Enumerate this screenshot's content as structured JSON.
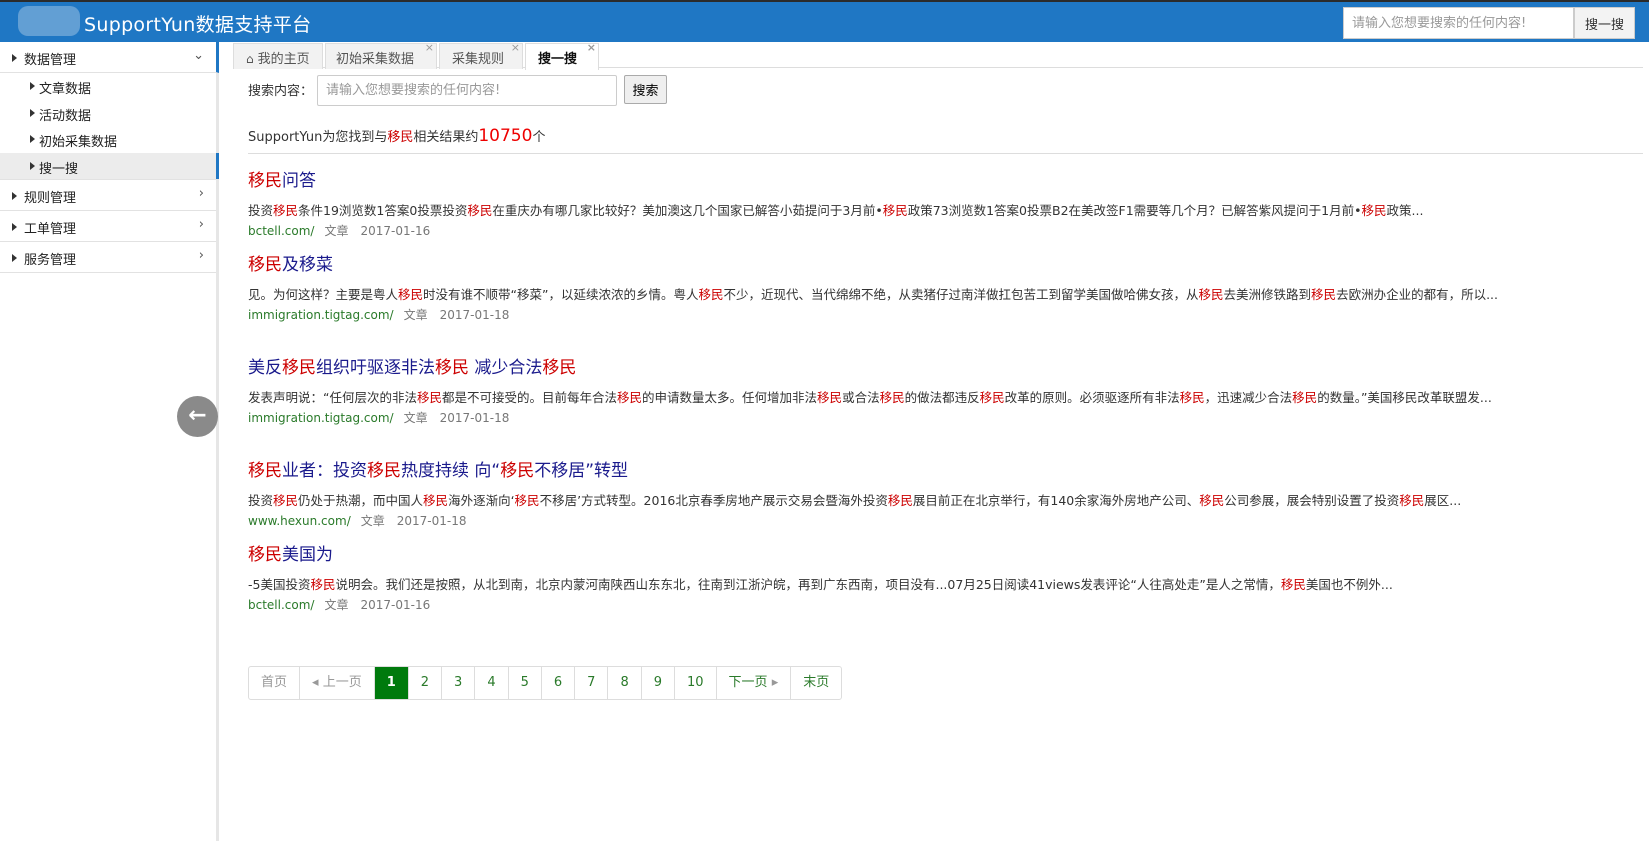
{
  "header": {
    "title": "SupportYun数据支持平台",
    "search_placeholder": "请输入您想要搜索的任何内容!",
    "search_button": "搜一搜"
  },
  "sidebar": {
    "groups": [
      {
        "label": "数据管理",
        "chevron": "⌄",
        "open": true,
        "items": [
          "文章数据",
          "活动数据",
          "初始采集数据",
          "搜一搜"
        ]
      },
      {
        "label": "规则管理",
        "chevron": "›"
      },
      {
        "label": "工单管理",
        "chevron": "›"
      },
      {
        "label": "服务管理",
        "chevron": "›"
      }
    ],
    "collapse_icon": "←"
  },
  "tabs": [
    {
      "label": "我的主页",
      "icon": "home-icon"
    },
    {
      "label": "初始采集数据",
      "close": "×"
    },
    {
      "label": "采集规则",
      "close": "×"
    },
    {
      "label": "搜一搜",
      "close": "×",
      "active": true
    }
  ],
  "search": {
    "label": "搜索内容：",
    "placeholder": "请输入您想要搜索的任何内容!",
    "button": "搜索"
  },
  "summary": {
    "prefix": "SupportYun为您找到与",
    "keyword": "移民",
    "middle": "相关结果约",
    "count": "10750",
    "suffix": "个"
  },
  "results": [
    {
      "title": [
        {
          "t": "移民",
          "h": true
        },
        {
          "t": "问答"
        }
      ],
      "snippet": [
        {
          "t": "投资"
        },
        {
          "t": "移民",
          "h": true
        },
        {
          "t": "条件19浏览数1答案0投票投资"
        },
        {
          "t": "移民",
          "h": true
        },
        {
          "t": "在重庆办有哪几家比较好？美加澳这几个国家已解答小茹提问于3月前•"
        },
        {
          "t": "移民",
          "h": true
        },
        {
          "t": "政策73浏览数1答案0投票B2在美改签F1需要等几个月？已解答紫风提问于1月前•"
        },
        {
          "t": "移民",
          "h": true
        },
        {
          "t": "政策..."
        }
      ],
      "url": "bctell.com/",
      "type": "文章",
      "date": "2017-01-16"
    },
    {
      "title": [
        {
          "t": "移民",
          "h": true
        },
        {
          "t": "及移菜"
        }
      ],
      "snippet": [
        {
          "t": "见。为何这样？主要是粤人"
        },
        {
          "t": "移民",
          "h": true
        },
        {
          "t": "时没有谁不顺带“移菜”，以延续浓浓的乡情。粤人"
        },
        {
          "t": "移民",
          "h": true
        },
        {
          "t": "不少，近现代、当代绵绵不绝，从卖猪仔过南洋做扛包苦工到留学美国做哈佛女孩，从"
        },
        {
          "t": "移民",
          "h": true
        },
        {
          "t": "去美洲修铁路到"
        },
        {
          "t": "移民",
          "h": true
        },
        {
          "t": "去欧洲办企业的都有，所以..."
        }
      ],
      "url": "immigration.tigtag.com/",
      "type": "文章",
      "date": "2017-01-18"
    },
    {
      "title": [
        {
          "t": "美反"
        },
        {
          "t": "移民",
          "h": true
        },
        {
          "t": "组织吁驱逐非法"
        },
        {
          "t": "移民",
          "h": true
        },
        {
          "t": " 减少合法"
        },
        {
          "t": "移民",
          "h": true
        }
      ],
      "snippet": [
        {
          "t": "发表声明说：“任何层次的非法"
        },
        {
          "t": "移民",
          "h": true
        },
        {
          "t": "都是不可接受的。目前每年合法"
        },
        {
          "t": "移民",
          "h": true
        },
        {
          "t": "的申请数量太多。任何增加非法"
        },
        {
          "t": "移民",
          "h": true
        },
        {
          "t": "或合法"
        },
        {
          "t": "移民",
          "h": true
        },
        {
          "t": "的做法都违反"
        },
        {
          "t": "移民",
          "h": true
        },
        {
          "t": "改革的原则。必须驱逐所有非法"
        },
        {
          "t": "移民",
          "h": true
        },
        {
          "t": "，迅速减少合法"
        },
        {
          "t": "移民",
          "h": true
        },
        {
          "t": "的数量。”美国移民改革联盟发..."
        }
      ],
      "url": "immigration.tigtag.com/",
      "type": "文章",
      "date": "2017-01-18"
    },
    {
      "title": [
        {
          "t": "移民",
          "h": true
        },
        {
          "t": "业者：投资"
        },
        {
          "t": "移民",
          "h": true
        },
        {
          "t": "热度持续 向“"
        },
        {
          "t": "移民",
          "h": true
        },
        {
          "t": "不移居”转型"
        }
      ],
      "snippet": [
        {
          "t": "投资"
        },
        {
          "t": "移民",
          "h": true
        },
        {
          "t": "仍处于热潮，而中国人"
        },
        {
          "t": "移民",
          "h": true
        },
        {
          "t": "海外逐渐向‘"
        },
        {
          "t": "移民",
          "h": true
        },
        {
          "t": "不移居’方式转型。2016北京春季房地产展示交易会暨海外投资"
        },
        {
          "t": "移民",
          "h": true
        },
        {
          "t": "展目前正在北京举行，有140余家海外房地产公司、"
        },
        {
          "t": "移民",
          "h": true
        },
        {
          "t": "公司参展，展会特别设置了投资"
        },
        {
          "t": "移民",
          "h": true
        },
        {
          "t": "展区..."
        }
      ],
      "url": "www.hexun.com/",
      "type": "文章",
      "date": "2017-01-18"
    },
    {
      "title": [
        {
          "t": "移民",
          "h": true
        },
        {
          "t": "美国为"
        }
      ],
      "snippet": [
        {
          "t": "-5美国投资"
        },
        {
          "t": "移民",
          "h": true
        },
        {
          "t": "说明会。我们还是按照，从北到南，北京内蒙河南陕西山东东北，往南到江浙沪皖，再到广东西南，项目没有...07月25日阅读41views发表评论“人往高处走”是人之常情，"
        },
        {
          "t": "移民",
          "h": true
        },
        {
          "t": "美国也不例外..."
        }
      ],
      "url": "bctell.com/",
      "type": "文章",
      "date": "2017-01-16"
    }
  ],
  "pagination": {
    "first": "首页",
    "prev": "上一页",
    "pages": [
      "1",
      "2",
      "3",
      "4",
      "5",
      "6",
      "7",
      "8",
      "9",
      "10"
    ],
    "current": "1",
    "next": "下一页",
    "last": "末页"
  }
}
